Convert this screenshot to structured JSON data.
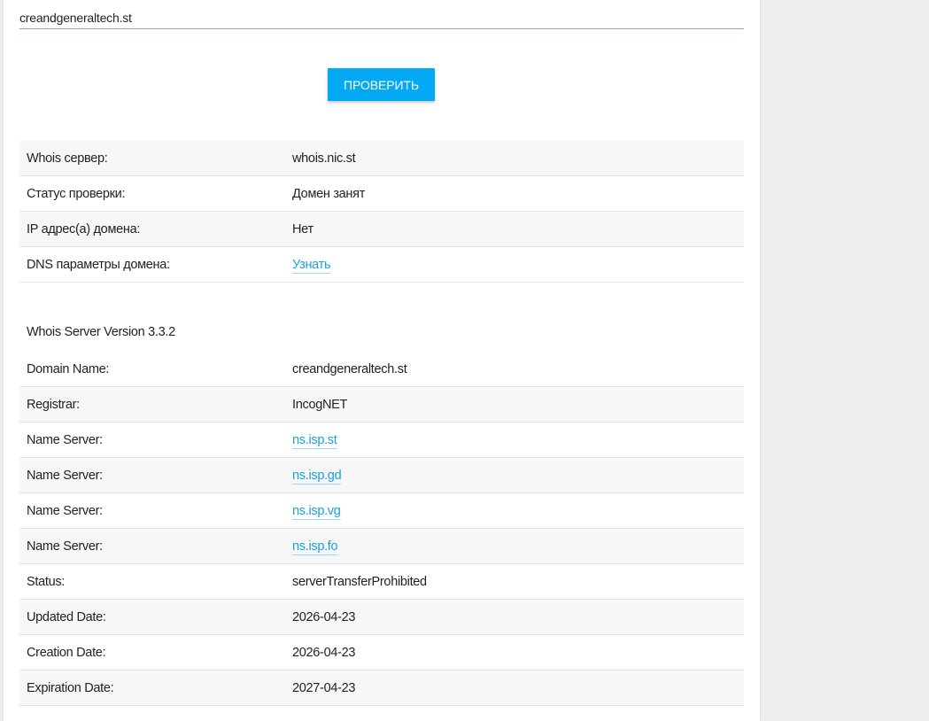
{
  "form": {
    "domain_value": "creandgeneraltech.st",
    "check_button": "ПРОВЕРИТЬ"
  },
  "summary": [
    {
      "key": "Whois сервер:",
      "value": "whois.nic.st",
      "link": false
    },
    {
      "key": "Статус проверки:",
      "value": "Домен занят",
      "link": false
    },
    {
      "key": "IP адрес(а) домена:",
      "value": "Нет",
      "link": false
    },
    {
      "key": "DNS параметры домена:",
      "value": "Узнать",
      "link": true
    }
  ],
  "whois": {
    "header": "Whois Server Version 3.3.2",
    "rows": [
      {
        "key": "Domain Name:",
        "value": "creandgeneraltech.st",
        "link": false
      },
      {
        "key": "Registrar:",
        "value": "IncogNET",
        "link": false
      },
      {
        "key": "Name Server:",
        "value": "ns.isp.st",
        "link": true
      },
      {
        "key": "Name Server:",
        "value": "ns.isp.gd",
        "link": true
      },
      {
        "key": "Name Server:",
        "value": "ns.isp.vg",
        "link": true
      },
      {
        "key": "Name Server:",
        "value": "ns.isp.fo",
        "link": true
      },
      {
        "key": "Status:",
        "value": "serverTransferProhibited",
        "link": false
      },
      {
        "key": "Updated Date:",
        "value": "2026-04-23",
        "link": false
      },
      {
        "key": "Creation Date:",
        "value": "2026-04-23",
        "link": false
      },
      {
        "key": "Expiration Date:",
        "value": "2027-04-23",
        "link": false
      }
    ]
  },
  "colors": {
    "accent": "#03a9f4",
    "link": "#1a9fd8",
    "page_bg": "#ededed",
    "row_alt": "#f7f7f7"
  }
}
